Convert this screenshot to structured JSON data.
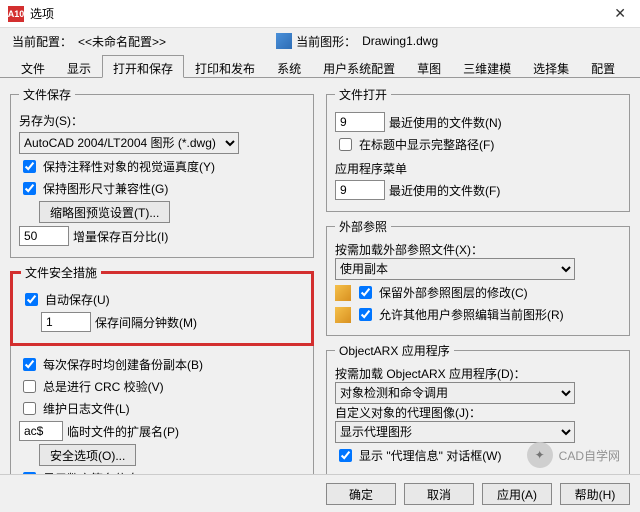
{
  "window": {
    "title": "选项",
    "app_badge": "A10"
  },
  "header": {
    "current_profile_label": "当前配置：",
    "current_profile_value": "<<未命名配置>>",
    "current_drawing_label": "当前图形：",
    "current_drawing_value": "Drawing1.dwg"
  },
  "tabs": [
    "文件",
    "显示",
    "打开和保存",
    "打印和发布",
    "系统",
    "用户系统配置",
    "草图",
    "三维建模",
    "选择集",
    "配置"
  ],
  "active_tab": "打开和保存",
  "file_save": {
    "legend": "文件保存",
    "saveas_label": "另存为(S)：",
    "format": "AutoCAD 2004/LT2004 图形 (*.dwg)",
    "keep_annotative": "保持注释性对象的视觉逼真度(Y)",
    "keep_size_compat": "保持图形尺寸兼容性(G)",
    "thumb_btn": "缩略图预览设置(T)...",
    "incr_value": "50",
    "incr_label": "增量保存百分比(I)"
  },
  "safety": {
    "legend": "文件安全措施",
    "autosave": "自动保存(U)",
    "interval_value": "1",
    "interval_label": "保存间隔分钟数(M)",
    "backup": "每次保存时均创建备份副本(B)",
    "crc": "总是进行 CRC 校验(V)",
    "log": "维护日志文件(L)",
    "ext_value": "ac$",
    "ext_label": "临时文件的扩展名(P)",
    "sec_btn": "安全选项(O)...",
    "sig": "显示数字签名信息(E)"
  },
  "file_open": {
    "legend": "文件打开",
    "recent_value": "9",
    "recent_label": "最近使用的文件数(N)",
    "fullpath": "在标题中显示完整路径(F)"
  },
  "app_menu": {
    "legend": "应用程序菜单",
    "recent_value": "9",
    "recent_label": "最近使用的文件数(F)"
  },
  "xref": {
    "legend": "外部参照",
    "load_label": "按需加载外部参照文件(X)：",
    "load_value": "使用副本",
    "retain": "保留外部参照图层的修改(C)",
    "allow_edit": "允许其他用户参照编辑当前图形(R)"
  },
  "arx": {
    "legend": "ObjectARX 应用程序",
    "load_label": "按需加载 ObjectARX 应用程序(D)：",
    "load_value": "对象检测和命令调用",
    "proxy_label": "自定义对象的代理图像(J)：",
    "proxy_value": "显示代理图形",
    "proxy_dialog": "显示 \"代理信息\" 对话框(W)"
  },
  "buttons": {
    "ok": "确定",
    "cancel": "取消",
    "apply": "应用(A)",
    "help": "帮助(H)"
  },
  "watermark": "CAD自学网"
}
